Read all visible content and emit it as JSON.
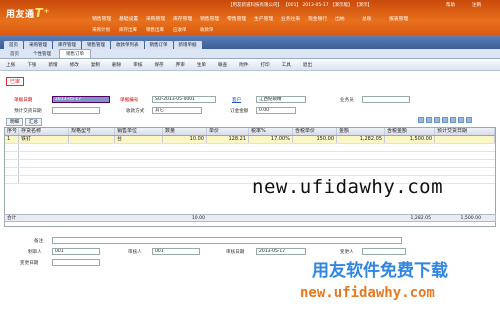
{
  "app": {
    "brand": "用友通",
    "brand_t": "T⁺",
    "title": "【用友新道科技有限公司】 【001】 2013-05-17 【演示版】 【演示】",
    "help": "帮助",
    "logout": "注销"
  },
  "menu": [
    "销售管理",
    "基础设置",
    "采购管理",
    "库存管理",
    "销售管理",
    "零售管理",
    "生产管理",
    "业务往来",
    "现金银行",
    "出纳",
    "总账",
    "报表管理"
  ],
  "submenu": [
    "采购计划",
    "库存出库",
    "销售出库",
    "应收单",
    "收款单"
  ],
  "workspace_tabs": [
    "首页",
    "采购管理",
    "库存管理",
    "销售管理",
    "收款单列表",
    "销售订单",
    "新增单据"
  ],
  "doc_tabs": {
    "tab1": "首页",
    "tab2": "个性管理",
    "tab3": "销售订单"
  },
  "toolbar": [
    "上张",
    "下张",
    "新增",
    "修改",
    "复制",
    "删除",
    "审核",
    "保存",
    "弃审",
    "生单",
    "联查",
    "附件",
    "打印",
    "工具",
    "退出"
  ],
  "status_tag": "已审",
  "form": {
    "date_label": "单据日期",
    "date": "2013-05-17",
    "code_label": "单据编号",
    "code": "SO-2013-05-0001",
    "customer_label": "客户",
    "customer": "江西纪硕精",
    "salesman_label": "业务员",
    "salesman": "",
    "delivery_label": "预计交货日期",
    "delivery": "",
    "paytype_label": "收款方式",
    "paytype": "其它",
    "deposit_label": "订金金额",
    "deposit": "0.00"
  },
  "detail_tabs": [
    "明细",
    "汇总"
  ],
  "columns": [
    "序号",
    "存货名称",
    "规格型号",
    "销售单位",
    "数量",
    "单价",
    "税率%",
    "含税单价",
    "金额",
    "含税金额",
    "预计交货日期"
  ],
  "rows": [
    {
      "no": "1",
      "name": "铁钉",
      "spec": "",
      "unit": "台",
      "qty": "10.00",
      "price": "128.21",
      "tax": "17.00%",
      "taxprice": "150.00",
      "amount": "1,282.05",
      "taxamount": "1,500.00",
      "date": ""
    }
  ],
  "total": {
    "label": "合计",
    "qty": "10.00",
    "amount": "1,282.05",
    "taxamount": "1,500.00"
  },
  "footer": {
    "remark_label": "备注",
    "maker_label": "制单人",
    "maker": "001",
    "auditor_label": "审核人",
    "auditor": "001",
    "audit_date_label": "审核日期",
    "audit_date": "2013-05-17",
    "modifier_label": "变更人",
    "change_date_label": "变更日期",
    "change_date": ""
  },
  "watermark": {
    "site": "new.ufidawhy.com",
    "cn": "用友软件免费下载",
    "site2": "new.ufidawhy.com"
  },
  "colors": {
    "header": "#d85a12",
    "tabbar": "#3b5d98",
    "selected_row": "#fbf6c6"
  }
}
